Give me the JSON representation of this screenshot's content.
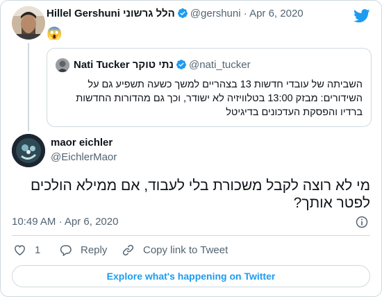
{
  "parent_tweet": {
    "name": "Hillel Gershuni הלל גרשוני",
    "handle": "@gershuni",
    "separator": "·",
    "date": "Apr 6, 2020",
    "text": "😱"
  },
  "quoted_tweet": {
    "name": "Nati Tucker נתי טוקר",
    "handle": "@nati_tucker",
    "text_lines": [
      "השביתה של עובדי חדשות 13 בצהריים למשך כשעה תשפיע גם על",
      "השידורים: מבזק 13:00 בטלוויזיה לא ישודר, וכך גם מהדורות החדשות",
      "ברדיו והפסקת העדכונים בדיגיטל"
    ]
  },
  "main_tweet": {
    "name": "maor eichler",
    "handle": "@EichlerMaor",
    "text": "מי לא רוצה לקבל משכורת בלי לעבוד, אם ממילא הולכים לפטר אותך?",
    "time": "10:49 AM",
    "separator": "·",
    "date": "Apr 6, 2020"
  },
  "actions": {
    "like_count": "1",
    "reply_label": "Reply",
    "copy_link_label": "Copy link to Tweet"
  },
  "explore_label": "Explore what's happening on Twitter",
  "colors": {
    "accent": "#1d9bf0",
    "secondary_text": "#536471",
    "border": "#cfd9de"
  },
  "icons": [
    "twitter-bird-icon",
    "verified-badge-icon",
    "info-icon",
    "heart-icon",
    "reply-icon",
    "link-icon"
  ]
}
